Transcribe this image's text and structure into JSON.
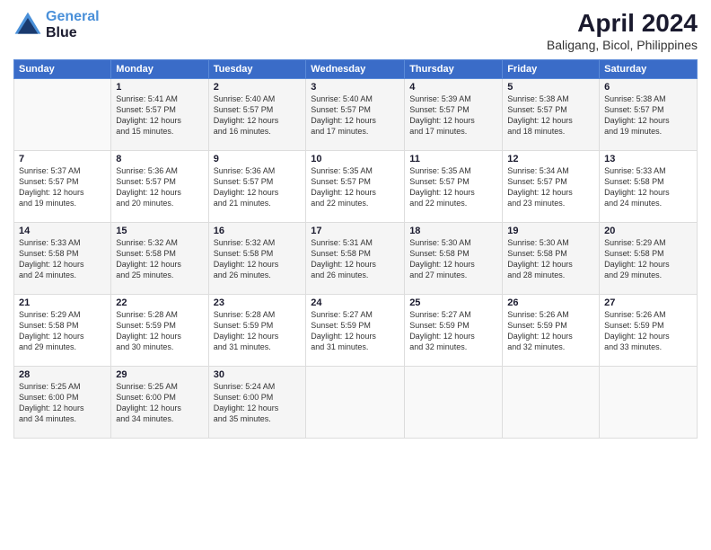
{
  "header": {
    "logo_line1": "General",
    "logo_line2": "Blue",
    "month": "April 2024",
    "location": "Baligang, Bicol, Philippines"
  },
  "days_of_week": [
    "Sunday",
    "Monday",
    "Tuesday",
    "Wednesday",
    "Thursday",
    "Friday",
    "Saturday"
  ],
  "weeks": [
    [
      {
        "day": "",
        "info": ""
      },
      {
        "day": "1",
        "info": "Sunrise: 5:41 AM\nSunset: 5:57 PM\nDaylight: 12 hours\nand 15 minutes."
      },
      {
        "day": "2",
        "info": "Sunrise: 5:40 AM\nSunset: 5:57 PM\nDaylight: 12 hours\nand 16 minutes."
      },
      {
        "day": "3",
        "info": "Sunrise: 5:40 AM\nSunset: 5:57 PM\nDaylight: 12 hours\nand 17 minutes."
      },
      {
        "day": "4",
        "info": "Sunrise: 5:39 AM\nSunset: 5:57 PM\nDaylight: 12 hours\nand 17 minutes."
      },
      {
        "day": "5",
        "info": "Sunrise: 5:38 AM\nSunset: 5:57 PM\nDaylight: 12 hours\nand 18 minutes."
      },
      {
        "day": "6",
        "info": "Sunrise: 5:38 AM\nSunset: 5:57 PM\nDaylight: 12 hours\nand 19 minutes."
      }
    ],
    [
      {
        "day": "7",
        "info": "Sunrise: 5:37 AM\nSunset: 5:57 PM\nDaylight: 12 hours\nand 19 minutes."
      },
      {
        "day": "8",
        "info": "Sunrise: 5:36 AM\nSunset: 5:57 PM\nDaylight: 12 hours\nand 20 minutes."
      },
      {
        "day": "9",
        "info": "Sunrise: 5:36 AM\nSunset: 5:57 PM\nDaylight: 12 hours\nand 21 minutes."
      },
      {
        "day": "10",
        "info": "Sunrise: 5:35 AM\nSunset: 5:57 PM\nDaylight: 12 hours\nand 22 minutes."
      },
      {
        "day": "11",
        "info": "Sunrise: 5:35 AM\nSunset: 5:57 PM\nDaylight: 12 hours\nand 22 minutes."
      },
      {
        "day": "12",
        "info": "Sunrise: 5:34 AM\nSunset: 5:57 PM\nDaylight: 12 hours\nand 23 minutes."
      },
      {
        "day": "13",
        "info": "Sunrise: 5:33 AM\nSunset: 5:58 PM\nDaylight: 12 hours\nand 24 minutes."
      }
    ],
    [
      {
        "day": "14",
        "info": "Sunrise: 5:33 AM\nSunset: 5:58 PM\nDaylight: 12 hours\nand 24 minutes."
      },
      {
        "day": "15",
        "info": "Sunrise: 5:32 AM\nSunset: 5:58 PM\nDaylight: 12 hours\nand 25 minutes."
      },
      {
        "day": "16",
        "info": "Sunrise: 5:32 AM\nSunset: 5:58 PM\nDaylight: 12 hours\nand 26 minutes."
      },
      {
        "day": "17",
        "info": "Sunrise: 5:31 AM\nSunset: 5:58 PM\nDaylight: 12 hours\nand 26 minutes."
      },
      {
        "day": "18",
        "info": "Sunrise: 5:30 AM\nSunset: 5:58 PM\nDaylight: 12 hours\nand 27 minutes."
      },
      {
        "day": "19",
        "info": "Sunrise: 5:30 AM\nSunset: 5:58 PM\nDaylight: 12 hours\nand 28 minutes."
      },
      {
        "day": "20",
        "info": "Sunrise: 5:29 AM\nSunset: 5:58 PM\nDaylight: 12 hours\nand 29 minutes."
      }
    ],
    [
      {
        "day": "21",
        "info": "Sunrise: 5:29 AM\nSunset: 5:58 PM\nDaylight: 12 hours\nand 29 minutes."
      },
      {
        "day": "22",
        "info": "Sunrise: 5:28 AM\nSunset: 5:59 PM\nDaylight: 12 hours\nand 30 minutes."
      },
      {
        "day": "23",
        "info": "Sunrise: 5:28 AM\nSunset: 5:59 PM\nDaylight: 12 hours\nand 31 minutes."
      },
      {
        "day": "24",
        "info": "Sunrise: 5:27 AM\nSunset: 5:59 PM\nDaylight: 12 hours\nand 31 minutes."
      },
      {
        "day": "25",
        "info": "Sunrise: 5:27 AM\nSunset: 5:59 PM\nDaylight: 12 hours\nand 32 minutes."
      },
      {
        "day": "26",
        "info": "Sunrise: 5:26 AM\nSunset: 5:59 PM\nDaylight: 12 hours\nand 32 minutes."
      },
      {
        "day": "27",
        "info": "Sunrise: 5:26 AM\nSunset: 5:59 PM\nDaylight: 12 hours\nand 33 minutes."
      }
    ],
    [
      {
        "day": "28",
        "info": "Sunrise: 5:25 AM\nSunset: 6:00 PM\nDaylight: 12 hours\nand 34 minutes."
      },
      {
        "day": "29",
        "info": "Sunrise: 5:25 AM\nSunset: 6:00 PM\nDaylight: 12 hours\nand 34 minutes."
      },
      {
        "day": "30",
        "info": "Sunrise: 5:24 AM\nSunset: 6:00 PM\nDaylight: 12 hours\nand 35 minutes."
      },
      {
        "day": "",
        "info": ""
      },
      {
        "day": "",
        "info": ""
      },
      {
        "day": "",
        "info": ""
      },
      {
        "day": "",
        "info": ""
      }
    ]
  ]
}
